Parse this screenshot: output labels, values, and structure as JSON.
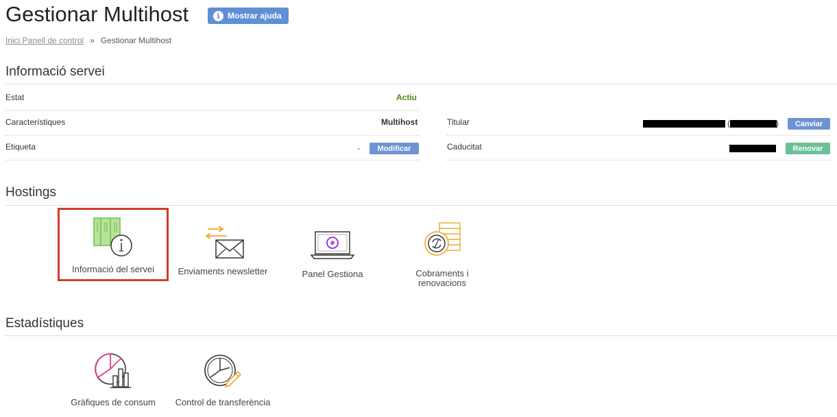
{
  "header": {
    "title": "Gestionar Multihost",
    "help_button_label": "Mostrar ajuda"
  },
  "breadcrumb": {
    "home_link": "Inici Panell de control",
    "separator": "»",
    "current": "Gestionar Multihost"
  },
  "service_info": {
    "section_title": "Informació servei",
    "estat_label": "Estat",
    "estat_value": "Actiu",
    "caracteristiques_label": "Característiques",
    "caracteristiques_value": "Multihost",
    "etiqueta_label": "Etiqueta",
    "etiqueta_value": "-",
    "modificar_button": "Modificar",
    "titular_label": "Titular",
    "titular_paren_open": "(",
    "titular_paren_close": ")",
    "canviar_button": "Canviar",
    "caducitat_label": "Caducitat",
    "renovar_button": "Renovar"
  },
  "hostings": {
    "section_title": "Hostings",
    "tiles": [
      {
        "label": "Informació del servei",
        "icon": "server-info-icon"
      },
      {
        "label": "Enviaments newsletter",
        "icon": "newsletter-envelope-icon"
      },
      {
        "label": "Panel Gestiona",
        "icon": "laptop-gestiona-icon"
      },
      {
        "label_line1": "Cobraments i",
        "label_line2": "renovacions",
        "icon": "coins-renewal-icon"
      }
    ]
  },
  "statistics": {
    "section_title": "Estadístiques",
    "tiles": [
      {
        "label": "Gràfiques de consum",
        "icon": "consumption-chart-icon"
      },
      {
        "label": "Control de transferència",
        "icon": "transfer-control-icon"
      }
    ]
  },
  "colors": {
    "accent_blue": "#6d93d3",
    "active_green": "#4c8a17",
    "renew_teal": "#6cbf9a",
    "highlight_red": "#d13b2c"
  }
}
